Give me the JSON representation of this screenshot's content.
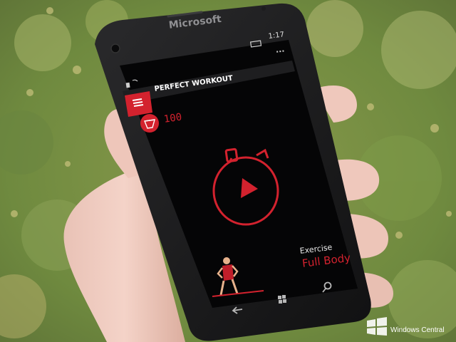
{
  "photo": {
    "phone_brand": "Microsoft",
    "watermark": "Windows Central"
  },
  "status_bar": {
    "time": "1:17"
  },
  "app_bar": {
    "more_glyph": "..."
  },
  "app": {
    "title": "PERFECT WORKOUT",
    "menu_icon": "hamburger-menu-icon",
    "gems_icon": "diamond-icon",
    "gems_count": "100",
    "timer_icon": "stopwatch-play-icon",
    "exercise_label": "Exercise",
    "exercise_value": "Full Body",
    "accent_color": "#d3222e"
  },
  "nav_bar": {
    "back_icon": "back-arrow-icon",
    "start_icon": "windows-logo-icon",
    "search_icon": "search-icon"
  }
}
